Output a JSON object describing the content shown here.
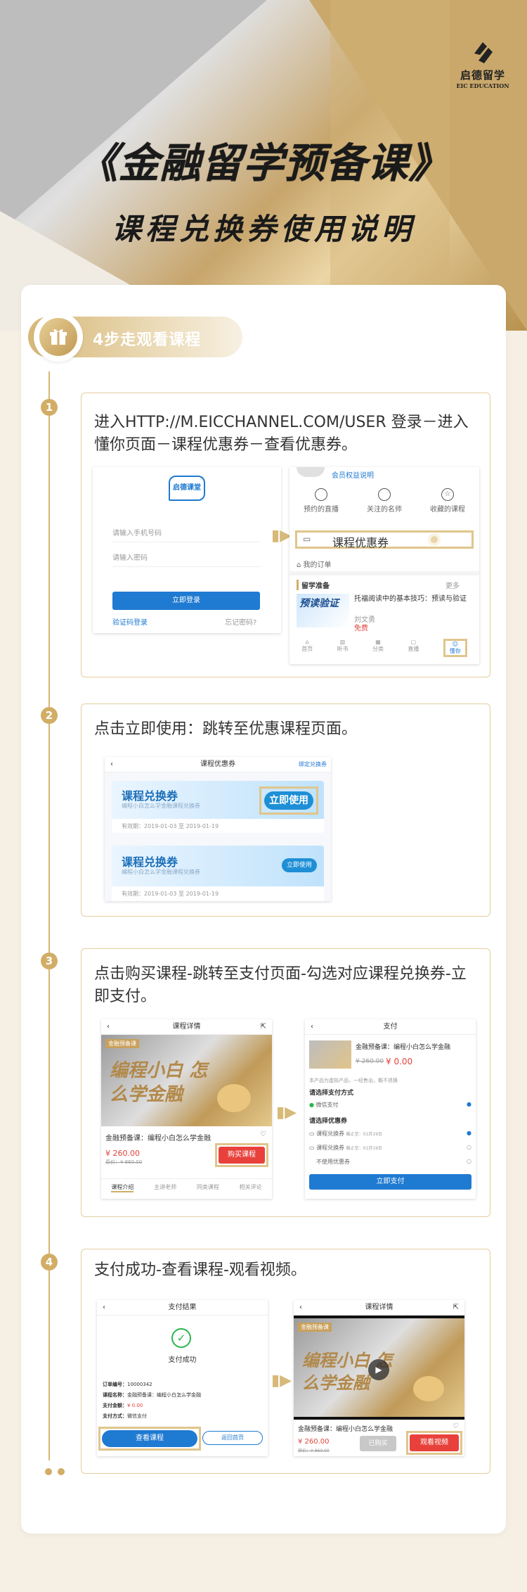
{
  "brand": {
    "name": "启德留学",
    "name_en": "EIC EDUCATION"
  },
  "hero": {
    "title": "《金融留学预备课》",
    "subtitle": "课程兑换券使用说明"
  },
  "section": {
    "label": "4步走观看课程"
  },
  "steps": [
    {
      "num": "1",
      "text": "进入HTTP://M.EICCHANNEL.COM/USER  登录－进入懂你页面－课程优惠券－查看优惠券。"
    },
    {
      "num": "2",
      "text": "点击立即使用：跳转至优惠课程页面。"
    },
    {
      "num": "3",
      "text": "点击购买课程-跳转至支付页面-勾选对应课程兑换券-立即支付。"
    },
    {
      "num": "4",
      "text": "支付成功-查看课程-观看视频。"
    }
  ],
  "s1": {
    "login": {
      "logo": "启德课堂",
      "phone_ph": "请输入手机号码",
      "pwd_ph": "请输入密码",
      "btn": "立即登录",
      "sms": "验证码登录",
      "forgot": "忘记密码?"
    },
    "mine": {
      "vip": "会员权益说明",
      "icons": [
        "预约的直播",
        "关注的名师",
        "收藏的课程"
      ],
      "coupon": "课程优惠券",
      "orders": "我的订单",
      "prep": "留学准备",
      "more": "更多",
      "course": "托福阅读中的基本技巧：预读与验证",
      "course_img": "预读验证",
      "teacher": "刘文勇",
      "free": "免费",
      "tabs": [
        "首页",
        "听书",
        "分类",
        "直播",
        "懂你"
      ]
    }
  },
  "s2": {
    "title": "课程优惠券",
    "bind": "绑定兑换券",
    "coupon": "课程兑换券",
    "desc": "编程小白怎么学金融课程兑换券",
    "valid": "有效期：2019-01-03 至 2019-01-19",
    "use": "立即使用"
  },
  "s3": {
    "detail": {
      "title": "课程详情",
      "promo_tag": "金融预备课",
      "promo": "编程小白 怎么学金融",
      "name": "金融预备课：编程小白怎么学金融",
      "price": "¥ 260.00",
      "orig": "原价：¥ 860.00",
      "buy": "购买课程",
      "tabs": [
        "课程介绍",
        "主讲老师",
        "同类课程",
        "相关评论"
      ]
    },
    "pay": {
      "title": "支付",
      "course": "金融预备课：编程小白怎么学金融",
      "orig": "¥ 260.00",
      "price": "¥ 0.00",
      "note": "本产品为虚拟产品，一经售出，概不退换",
      "method": "请选择支付方式",
      "wechat": "微信支付",
      "coupon_h": "请选择优惠券",
      "c1": "课程兑换券",
      "c1d": "截止至：01月19日",
      "c2": "课程兑换券",
      "c2d": "截止至：01月19日",
      "none": "不使用优惠券",
      "btn": "立即支付"
    }
  },
  "s4": {
    "result": {
      "title": "支付结果",
      "ok": "支付成功",
      "rows": [
        {
          "k": "订单编号：",
          "v": "10000342"
        },
        {
          "k": "课程名称：",
          "v": "金融预备课：编程小白怎么学金融"
        },
        {
          "k": "支付金额：",
          "v": "¥ 0.00"
        },
        {
          "k": "支付方式：",
          "v": "微信支付"
        }
      ],
      "view": "查看课程",
      "home": "返回首页"
    },
    "detail": {
      "title": "课程详情",
      "promo_tag": "金融预备课",
      "promo": "编程小白 怎么学金融",
      "name": "金融预备课：编程小白怎么学金融",
      "price": "¥ 260.00",
      "orig": "原价：¥ 860.00",
      "bought": "已购买",
      "watch": "观看视频"
    }
  }
}
